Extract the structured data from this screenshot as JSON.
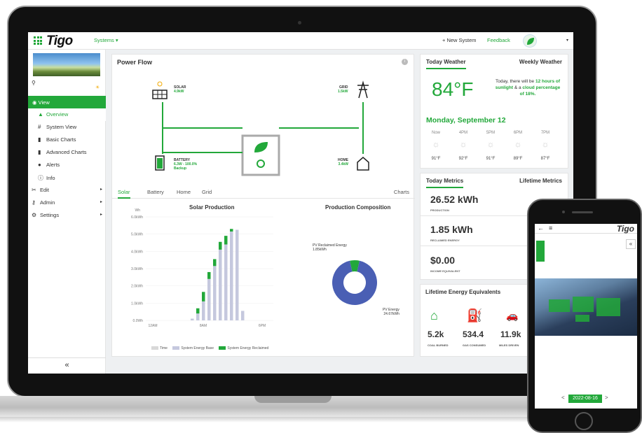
{
  "topbar": {
    "logo": "Tigo",
    "systems_menu": "Systems ▾",
    "new_system": "+ New System",
    "feedback": "Feedback",
    "user_caret": "▾"
  },
  "sidebar": {
    "items": [
      {
        "label": "View",
        "icon": "eye-icon"
      },
      {
        "label": "Overview",
        "icon": "triangle-icon"
      },
      {
        "label": "System View",
        "icon": "grid-icon"
      },
      {
        "label": "Basic Charts",
        "icon": "bar-chart-icon"
      },
      {
        "label": "Advanced Charts",
        "icon": "bar-chart-icon"
      },
      {
        "label": "Alerts",
        "icon": "alert-icon"
      },
      {
        "label": "Info",
        "icon": "info-icon"
      },
      {
        "label": "Edit",
        "icon": "tools-icon"
      },
      {
        "label": "Admin",
        "icon": "key-icon"
      },
      {
        "label": "Settings",
        "icon": "gear-icon"
      }
    ],
    "collapse": "«"
  },
  "power_flow": {
    "title": "Power Flow",
    "solar_label": "SOLAR",
    "solar_value": "4.9kW",
    "grid_label": "GRID",
    "grid_value": "1.5kW",
    "battery_label": "BATTERY",
    "battery_value": "6.3W - 100.0%",
    "battery_mode": "Backup",
    "home_label": "HOME",
    "home_value": "3.4kW",
    "tabs": [
      "Solar",
      "Battery",
      "Home",
      "Grid"
    ],
    "charts_link": "Charts"
  },
  "chart_data": [
    {
      "type": "bar",
      "title": "Solar Production",
      "ylabel": "Wh",
      "ylim": [
        0,
        6000
      ],
      "yticks": [
        "6.0kWh",
        "5.0kWh",
        "4.0kWh",
        "3.0kWh",
        "2.0kWh",
        "1.0kWh",
        "0.0Wh"
      ],
      "xticks": [
        "12AM",
        "8AM",
        "6PM"
      ],
      "legend": [
        "Time",
        "System Energy Base",
        "System Energy Reclaimed"
      ],
      "categories": [
        "7AM",
        "8AM",
        "9AM",
        "10AM",
        "11AM",
        "12PM",
        "1PM",
        "2PM",
        "3PM",
        "4PM"
      ],
      "series": [
        {
          "name": "System Energy Base",
          "values": [
            100,
            400,
            1100,
            2400,
            3150,
            4100,
            4400,
            5150,
            5250,
            550
          ]
        },
        {
          "name": "System Energy Reclaimed",
          "values": [
            0,
            300,
            550,
            400,
            400,
            450,
            500,
            150,
            0,
            0
          ]
        }
      ],
      "colors": {
        "base": "#c5c8de",
        "reclaimed": "#22a83a",
        "time": "#d8d8d8"
      }
    },
    {
      "type": "pie",
      "title": "Production Composition",
      "labels": [
        "PV Reclaimed Energy",
        "PV Energy"
      ],
      "value_labels": [
        "1.85kWh",
        "24.67kWh"
      ],
      "values": [
        1.85,
        24.67
      ],
      "colors": [
        "#22a83a",
        "#4a5fb4"
      ]
    }
  ],
  "weather": {
    "tab_today": "Today Weather",
    "tab_weekly": "Weekly Weather",
    "temp": "84°F",
    "desc_pre": "Today, there will be",
    "desc_hours": "12 hours of sunlight",
    "desc_mid": "& a",
    "desc_cloud": "cloud percentage of 18%.",
    "date": "Monday, September 12",
    "hours": [
      {
        "label": "Now",
        "temp": "91°F"
      },
      {
        "label": "4PM",
        "temp": "92°F"
      },
      {
        "label": "5PM",
        "temp": "91°F"
      },
      {
        "label": "6PM",
        "temp": "89°F"
      },
      {
        "label": "7PM",
        "temp": "87°F"
      }
    ]
  },
  "metrics": {
    "tab_today": "Today Metrics",
    "tab_lifetime": "Lifetime Metrics",
    "items": [
      {
        "value": "26.52 kWh",
        "label": "PRODUCTION"
      },
      {
        "value": "1.85 kWh",
        "label": "RECLAIMED ENERGY"
      },
      {
        "value": "$0.00",
        "label": "INCOME EQUIVALENT"
      }
    ]
  },
  "equivalents": {
    "title": "Lifetime Energy Equivalents",
    "items": [
      {
        "value": "5.2k",
        "label": "COAL BURNED",
        "icon": "factory-icon"
      },
      {
        "value": "534.4",
        "label": "GAS CONSUMED",
        "icon": "gas-pump-icon"
      },
      {
        "value": "11.9k",
        "label": "MILES DRIVEN",
        "icon": "car-icon"
      }
    ]
  },
  "phone": {
    "logo": "Tigo",
    "back": "←",
    "menu": "≡",
    "collapse": "«",
    "date": "2022-08-16",
    "prev": "<",
    "next": ">"
  }
}
